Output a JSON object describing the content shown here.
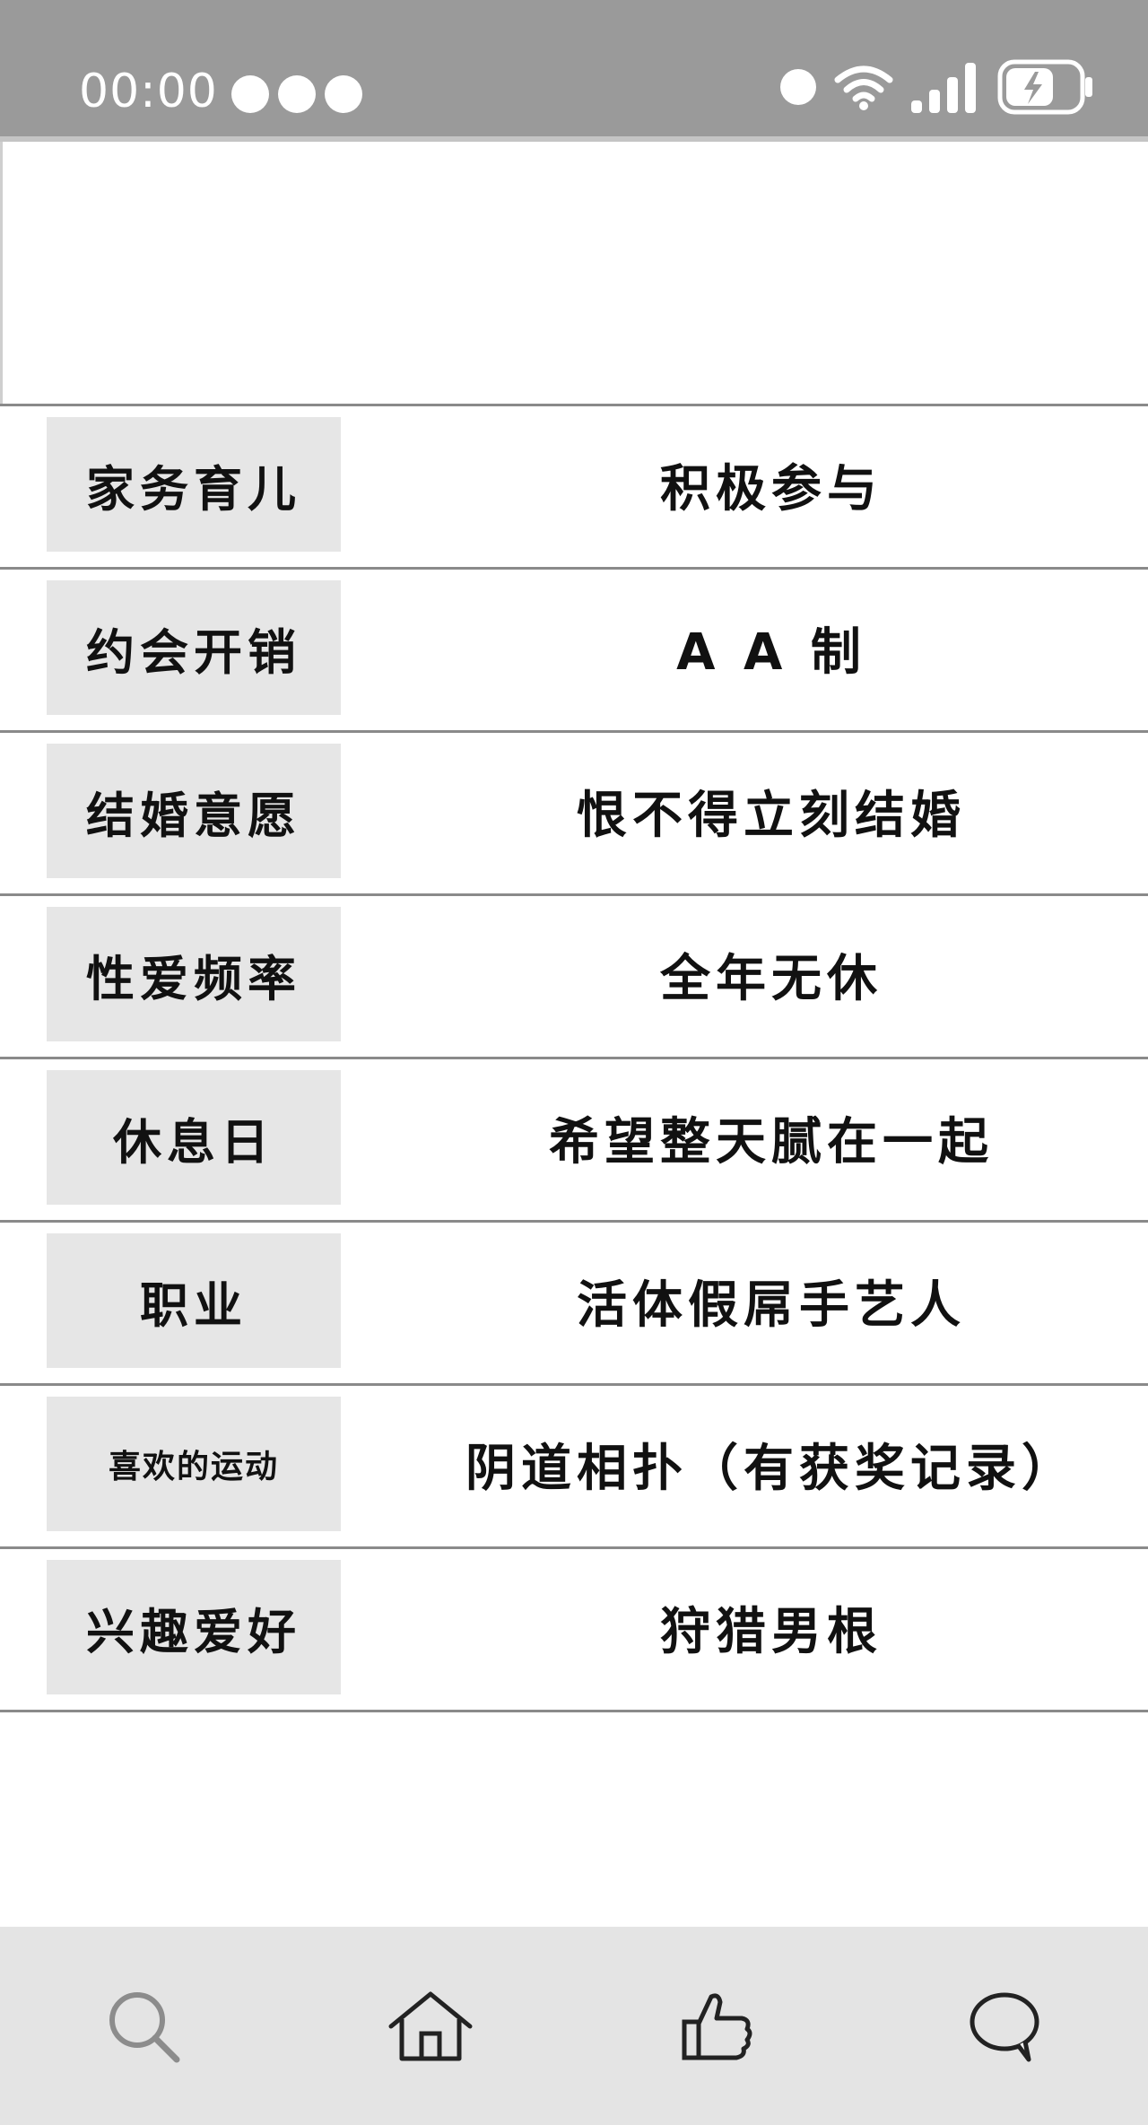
{
  "status_bar": {
    "time": "00:00"
  },
  "rows": [
    {
      "label": "家务育儿",
      "value": "积极参与"
    },
    {
      "label": "约会开销",
      "value": "A A 制"
    },
    {
      "label": "结婚意愿",
      "value": "恨不得立刻结婚"
    },
    {
      "label": "性爱频率",
      "value": "全年无休"
    },
    {
      "label": "休息日",
      "value": "希望整天腻在一起"
    },
    {
      "label": "职业",
      "value": "活体假屌手艺人"
    },
    {
      "label": "喜欢的运动",
      "value": "阴道相扑（有获奖记录）"
    },
    {
      "label": "兴趣爱好",
      "value": "狩猎男根"
    }
  ],
  "tab_bar": {
    "icons": [
      "search-icon",
      "home-icon",
      "thumbs-up-icon",
      "chat-icon"
    ]
  },
  "colors": {
    "status_bar_bg": "#9a9a9a",
    "label_bg": "#e6e6e6",
    "tab_bar_bg": "#e4e4e4",
    "divider": "#8a8a8a"
  }
}
